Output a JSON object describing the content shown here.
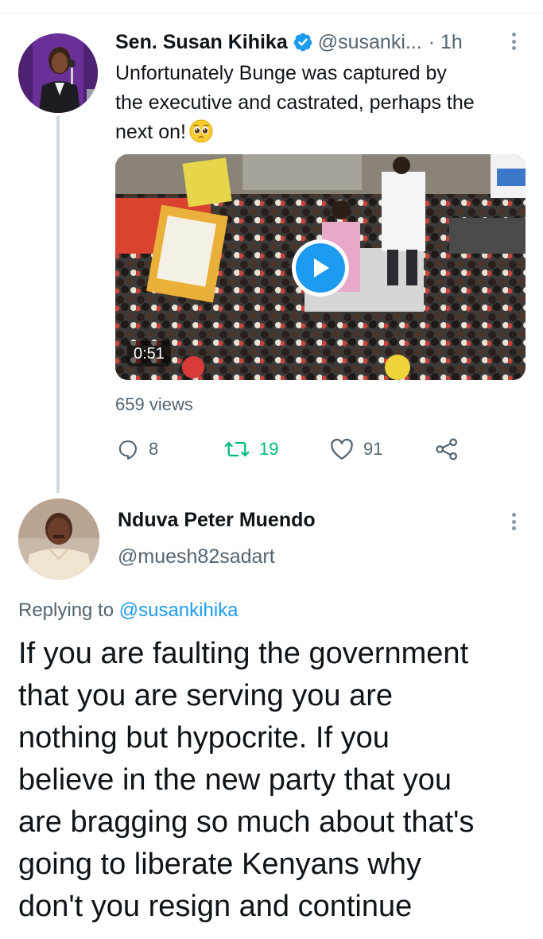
{
  "tweet": {
    "author_name": "Sen. Susan Kihika",
    "author_handle": "@susanki...",
    "time": "· 1h",
    "text_lines": [
      "Unfortunately Bunge was captured by",
      "the executive and castrated, perhaps the",
      "next on!"
    ],
    "emoji": "pleading-face",
    "media": {
      "type": "video",
      "duration": "0:51"
    },
    "views": "659 views",
    "stats": {
      "replies": "8",
      "retweets": "19",
      "likes": "91"
    }
  },
  "reply": {
    "author_name": "Nduva Peter Muendo",
    "author_handle": "@muesh82sadart",
    "replying_prefix": "Replying to ",
    "replying_mention": "@susankihika",
    "text_lines": [
      "If you are faulting the government",
      "that you are serving you are",
      "nothing but hypocrite. If you",
      "believe in the new party that you",
      "are bragging so much about that's",
      "going to liberate Kenyans why",
      "don't you resign and continue"
    ]
  },
  "colors": {
    "accent": "#1d9bf0",
    "retweet_green": "#00ba7c",
    "secondary_text": "#536471",
    "thread_line": "#cfd9de"
  }
}
